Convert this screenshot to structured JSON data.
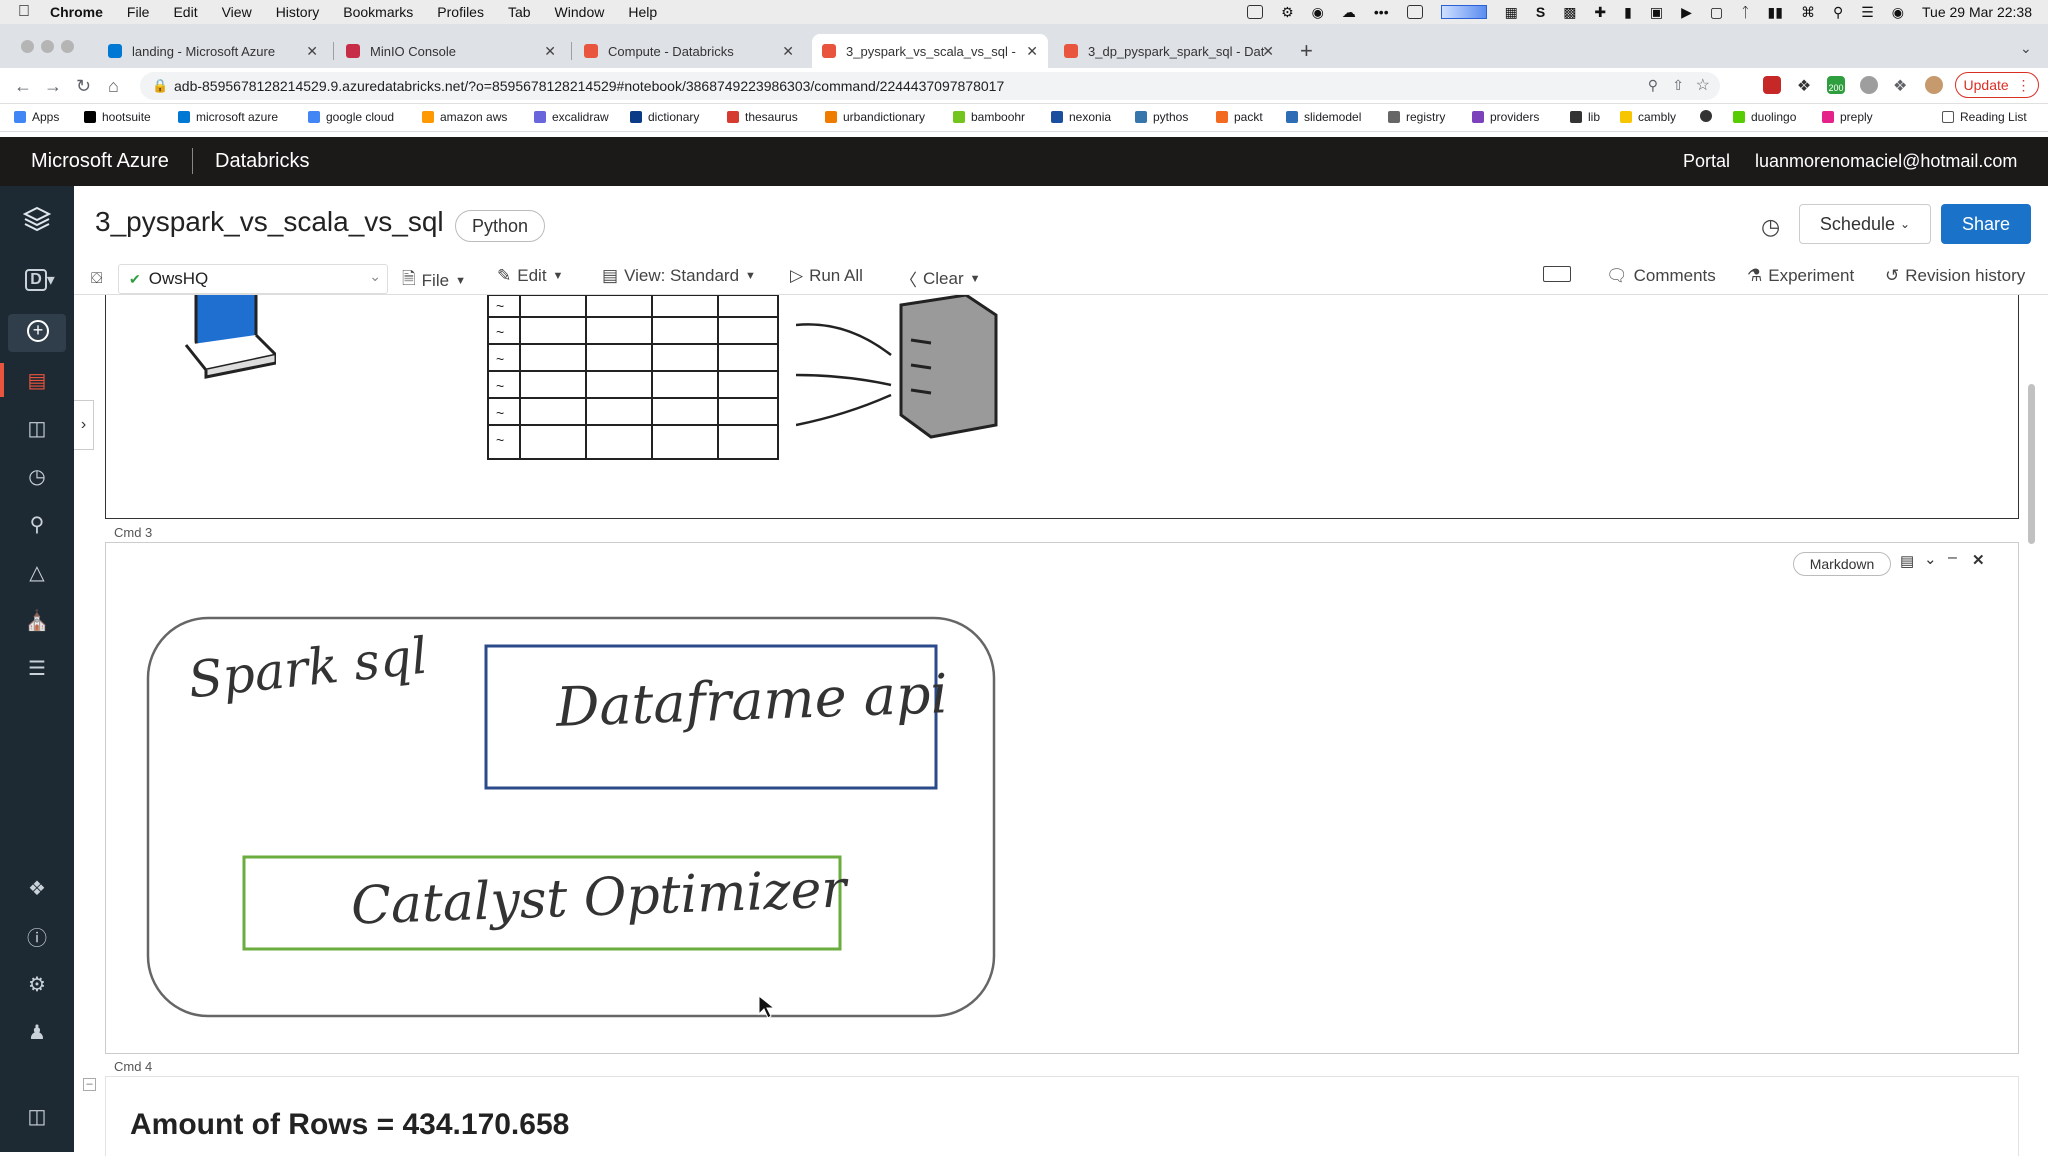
{
  "menubar": {
    "app": "Chrome",
    "items": [
      "File",
      "Edit",
      "View",
      "History",
      "Bookmarks",
      "Profiles",
      "Tab",
      "Window",
      "Help"
    ],
    "clock": "Tue 29 Mar  22:38"
  },
  "tabs": [
    {
      "label": "landing - Microsoft Azure",
      "color": "#0078d4"
    },
    {
      "label": "MinIO Console",
      "color": "#c72c48"
    },
    {
      "label": "Compute - Databricks",
      "color": "#e8543e"
    },
    {
      "label": "3_pyspark_vs_scala_vs_sql - ",
      "color": "#e8543e"
    },
    {
      "label": "3_dp_pyspark_spark_sql - Dat",
      "color": "#e8543e"
    }
  ],
  "address": {
    "url": "adb-8595678128214529.9.azuredatabricks.net/?o=8595678128214529#notebook/3868749223986303/command/2244437097878017",
    "update_label": "Update",
    "ext_badge": "200"
  },
  "bookmarks": [
    {
      "label": "Apps",
      "color": "#4285f4"
    },
    {
      "label": "hootsuite",
      "color": "#000000"
    },
    {
      "label": "microsoft azure",
      "color": "#0078d4"
    },
    {
      "label": "google cloud",
      "color": "#4285f4"
    },
    {
      "label": "amazon aws",
      "color": "#ff9900"
    },
    {
      "label": "excalidraw",
      "color": "#6965db"
    },
    {
      "label": "dictionary",
      "color": "#0b3a86"
    },
    {
      "label": "thesaurus",
      "color": "#d63b2f"
    },
    {
      "label": "urbandictionary",
      "color": "#ef7c00"
    },
    {
      "label": "bamboohr",
      "color": "#73c41d"
    },
    {
      "label": "nexonia",
      "color": "#1a4fa0"
    },
    {
      "label": "pythos",
      "color": "#3776ab"
    },
    {
      "label": "packt",
      "color": "#f26b21"
    },
    {
      "label": "slidemodel",
      "color": "#2d6db5"
    },
    {
      "label": "registry",
      "color": "#666666"
    },
    {
      "label": "providers",
      "color": "#7b42bc"
    },
    {
      "label": "lib",
      "color": "#333333"
    },
    {
      "label": "cambly",
      "color": "#f7c600"
    },
    {
      "label": "",
      "color": "#333333"
    },
    {
      "label": "duolingo",
      "color": "#58cc02"
    },
    {
      "label": "preply",
      "color": "#e5218a"
    }
  ],
  "reading_list": "Reading List",
  "azure_header": {
    "brand": "Microsoft Azure",
    "product": "Databricks",
    "portal": "Portal",
    "user": "luanmorenomaciel@hotmail.com"
  },
  "notebook": {
    "title": "3_pyspark_vs_scala_vs_sql",
    "language": "Python",
    "schedule_label": "Schedule",
    "share_label": "Share",
    "cluster": "OwsHQ",
    "toolbar": {
      "file": "File",
      "edit": "Edit",
      "view": "View: Standard",
      "run_all": "Run All",
      "clear": "Clear",
      "comments": "Comments",
      "experiment": "Experiment",
      "revision": "Revision history"
    }
  },
  "cells": {
    "cmd3": "Cmd  3",
    "cmd3_badge": "Markdown",
    "diagram": {
      "spark_sql": "Spark sql",
      "dataframe_api": "Dataframe api",
      "catalyst": "Catalyst Optimizer"
    },
    "cmd4": "Cmd  4",
    "rows_heading": "Amount of Rows = 434.170.658"
  },
  "colors": {
    "azure_header": "#1b1a19",
    "sidebar": "#1e2a33",
    "share": "#1a73c8",
    "dataframe_box": "#2b4a8a",
    "catalyst_box": "#6aac3d"
  }
}
